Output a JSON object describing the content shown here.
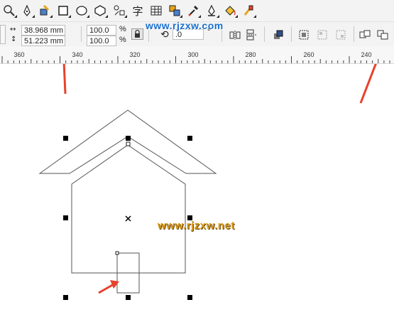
{
  "toolbar": {
    "tools": [
      {
        "name": "zoom-tool-icon"
      },
      {
        "name": "freehand-tool-icon"
      },
      {
        "name": "smart-fill-tool-icon"
      },
      {
        "name": "rectangle-tool-icon"
      },
      {
        "name": "ellipse-tool-icon"
      },
      {
        "name": "polygon-tool-icon"
      },
      {
        "name": "basic-shapes-tool-icon"
      },
      {
        "name": "text-tool-icon",
        "glyph": "字"
      },
      {
        "name": "table-tool-icon"
      },
      {
        "name": "interactive-tool-icon"
      },
      {
        "name": "eyedropper-tool-icon"
      },
      {
        "name": "outline-pen-tool-icon"
      },
      {
        "name": "fill-tool-icon"
      },
      {
        "name": "interactive-fill-tool-icon"
      }
    ]
  },
  "properties": {
    "width": "38.968 mm",
    "height": "51.223 mm",
    "scale_x": "100.0",
    "scale_y": "100.0",
    "percent_x": "%",
    "percent_y": "%",
    "rotation": ".0",
    "degree": "°"
  },
  "ruler": {
    "labels": [
      "360",
      "340",
      "320",
      "300",
      "280",
      "260",
      "240"
    ]
  },
  "watermarks": {
    "top": "www.rjzxw.com",
    "canvas": "www.rjzxw.net"
  },
  "colors": {
    "toolbar_bg": "#f3f3f3",
    "arrow_red": "#e8412b",
    "watermark_blue": "#1a6fd1",
    "watermark_gold": "#d99a1b"
  }
}
